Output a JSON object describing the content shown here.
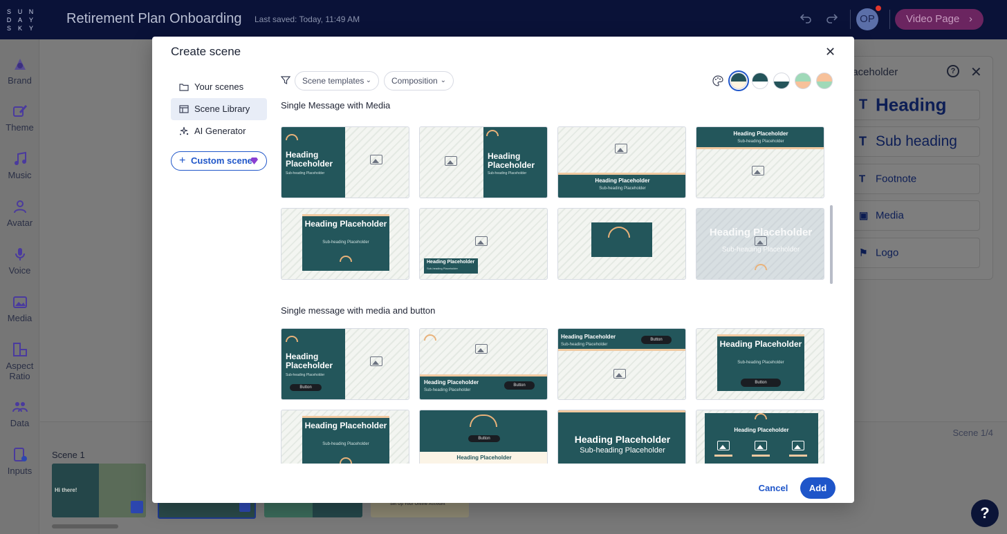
{
  "topbar": {
    "logo_letters": [
      "S",
      "U",
      "N",
      "D",
      "A",
      "Y",
      "S",
      "K",
      "Y"
    ],
    "title": "Retirement Plan Onboarding",
    "last_saved": "Last saved: Today, 11:49 AM",
    "avatar_initials": "OP",
    "video_page_label": "Video Page",
    "accent": "#6b2560"
  },
  "rail": {
    "items": [
      {
        "label": "Brand",
        "icon": "brand-icon"
      },
      {
        "label": "Theme",
        "icon": "theme-icon"
      },
      {
        "label": "Music",
        "icon": "music-icon"
      },
      {
        "label": "Avatar",
        "icon": "avatar-icon"
      },
      {
        "label": "Voice",
        "icon": "microphone-icon"
      },
      {
        "label": "Media",
        "icon": "media-icon"
      },
      {
        "label": "Aspect Ratio",
        "icon": "aspect-ratio-icon"
      },
      {
        "label": "Data",
        "icon": "data-icon"
      },
      {
        "label": "Inputs",
        "icon": "inputs-icon"
      }
    ]
  },
  "properties": {
    "title": "laceholder",
    "items": [
      "Heading",
      "Sub heading",
      "Footnote",
      "Media",
      "Logo"
    ]
  },
  "scenes": {
    "label": "Scene 1",
    "counter": "Scene 1/4",
    "thumb1_heading": "Hi there!",
    "thumb4_heading": "Set Up Your Online Account"
  },
  "modal": {
    "title": "Create scene",
    "nav": [
      {
        "label": "Your scenes",
        "icon": "folder-icon",
        "active": false
      },
      {
        "label": "Scene Library",
        "icon": "library-icon",
        "active": true
      },
      {
        "label": "AI Generator",
        "icon": "sparkle-icon",
        "active": false
      }
    ],
    "custom_scene_label": "Custom scene",
    "filters": [
      {
        "label": "Scene templates"
      },
      {
        "label": "Composition"
      }
    ],
    "palette_swatches": [
      {
        "top": "#24545a",
        "bottom": "#fff4e0",
        "selected": true
      },
      {
        "top": "#24545a",
        "bottom": "#ffffff",
        "selected": false
      },
      {
        "top": "#ffffff",
        "bottom": "#24545a",
        "selected": false
      },
      {
        "top": "#9fd9b8",
        "bottom": "#f7c19a",
        "selected": false
      },
      {
        "top": "#f7c19a",
        "bottom": "#9fd9b8",
        "selected": false
      }
    ],
    "sections": [
      {
        "title": "Single Message with Media",
        "cards": [
          {
            "heading": "Heading Placeholder",
            "sub": "Sub-heading Placeholder",
            "layout": "panel-left"
          },
          {
            "heading": "Heading Placeholder",
            "sub": "Sub-heading Placeholder",
            "layout": "panel-right"
          },
          {
            "heading": "Heading Placeholder",
            "sub": "Sub-heading Placeholder",
            "layout": "band-bottom"
          },
          {
            "heading": "Heading Placeholder",
            "sub": "Sub-heading Placeholder",
            "layout": "band-top"
          },
          {
            "heading": "Heading Placeholder",
            "sub": "Sub-heading Placeholder",
            "layout": "center-box"
          },
          {
            "heading": "Heading Placeholder",
            "sub": "Sub-heading Placeholder",
            "layout": "small-bottom-left"
          },
          {
            "heading": "",
            "sub": "",
            "layout": "logo-box"
          },
          {
            "heading": "Heading Placeholder",
            "sub": "Sub-heading Placeholder",
            "layout": "overlay"
          }
        ]
      },
      {
        "title": "Single message with media and button",
        "cards": [
          {
            "heading": "Heading Placeholder",
            "sub": "Sub-heading Placeholder",
            "button": "Button",
            "layout": "panel-left-btn"
          },
          {
            "heading": "Heading Placeholder",
            "sub": "Sub-heading Placeholder",
            "button": "Button",
            "layout": "band-bottom-btn"
          },
          {
            "heading": "Heading Placeholder",
            "sub": "Sub-heading Placeholder",
            "button": "Button",
            "layout": "band-top-btn"
          },
          {
            "heading": "Heading Placeholder",
            "sub": "Sub-heading Placeholder",
            "button": "Button",
            "layout": "center-box-btn"
          },
          {
            "heading": "Heading Placeholder",
            "sub": "Sub-heading Placeholder",
            "layout": "center-box"
          },
          {
            "heading": "Heading Placeholder",
            "sub": "",
            "button": "Button",
            "layout": "logo-top-btn"
          },
          {
            "heading": "Heading Placeholder",
            "sub": "Sub-heading Placeholder",
            "layout": "full-dark"
          },
          {
            "heading": "Heading Placeholder",
            "sub": "",
            "layout": "three-media"
          }
        ]
      }
    ],
    "cancel_label": "Cancel",
    "add_label": "Add",
    "brand_dark": "#23565b",
    "accent_blue": "#1e55c9"
  }
}
